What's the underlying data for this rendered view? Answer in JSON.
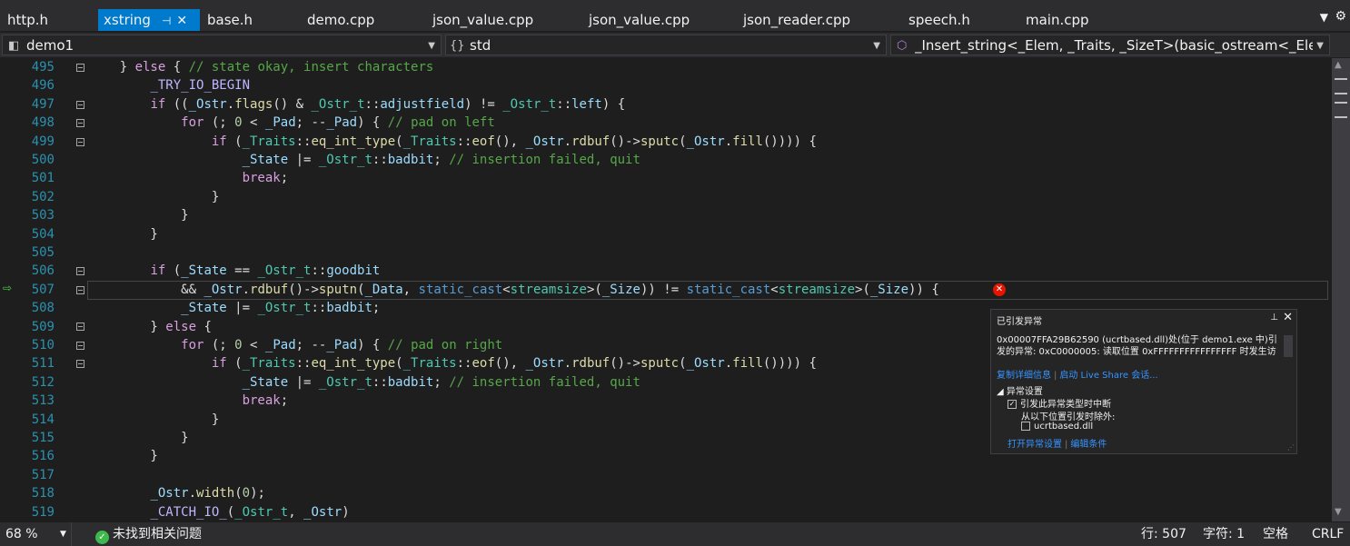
{
  "tabs": [
    {
      "label": "http.h",
      "active": false
    },
    {
      "label": "xstring",
      "active": true,
      "pin": "⊣",
      "close": "✕"
    },
    {
      "label": "base.h",
      "active": false
    },
    {
      "label": "demo.cpp",
      "active": false
    },
    {
      "label": "json_value.cpp",
      "active": false
    },
    {
      "label": "json_value.cpp",
      "active": false
    },
    {
      "label": "json_reader.cpp",
      "active": false
    },
    {
      "label": "speech.h",
      "active": false
    },
    {
      "label": "main.cpp",
      "active": false
    }
  ],
  "navbar": {
    "project": "demo1",
    "scope_icon": "{}",
    "scope": "std",
    "member": "_Insert_string<_Elem, _Traits, _SizeT>(basic_ostream<_Elem,"
  },
  "line_numbers": [
    "495",
    "496",
    "497",
    "498",
    "499",
    "500",
    "501",
    "502",
    "503",
    "504",
    "505",
    "506",
    "507",
    "508",
    "509",
    "510",
    "511",
    "512",
    "513",
    "514",
    "515",
    "516",
    "517",
    "518",
    "519"
  ],
  "exception_popup": {
    "title": "已引发异常",
    "message": "0x00007FFA29B62590 (ucrtbased.dll)处(位于 demo1.exe 中)引发的异常: 0xC0000005: 读取位置 0xFFFFFFFFFFFFFFFF 时发生访",
    "copy_details": "复制详细信息",
    "live_share": "启动 Live Share 会话...",
    "section": "异常设置",
    "break_when": "引发此异常类型时中断",
    "except_from": "从以下位置引发时除外:",
    "module": "ucrtbased.dll",
    "open_settings": "打开异常设置",
    "edit_conditions": "编辑条件"
  },
  "statusbar": {
    "zoom": "68 %",
    "issues": "未找到相关问题",
    "line": "行: 507",
    "col": "字符: 1",
    "spaces": "空格",
    "eol": "CRLF"
  }
}
